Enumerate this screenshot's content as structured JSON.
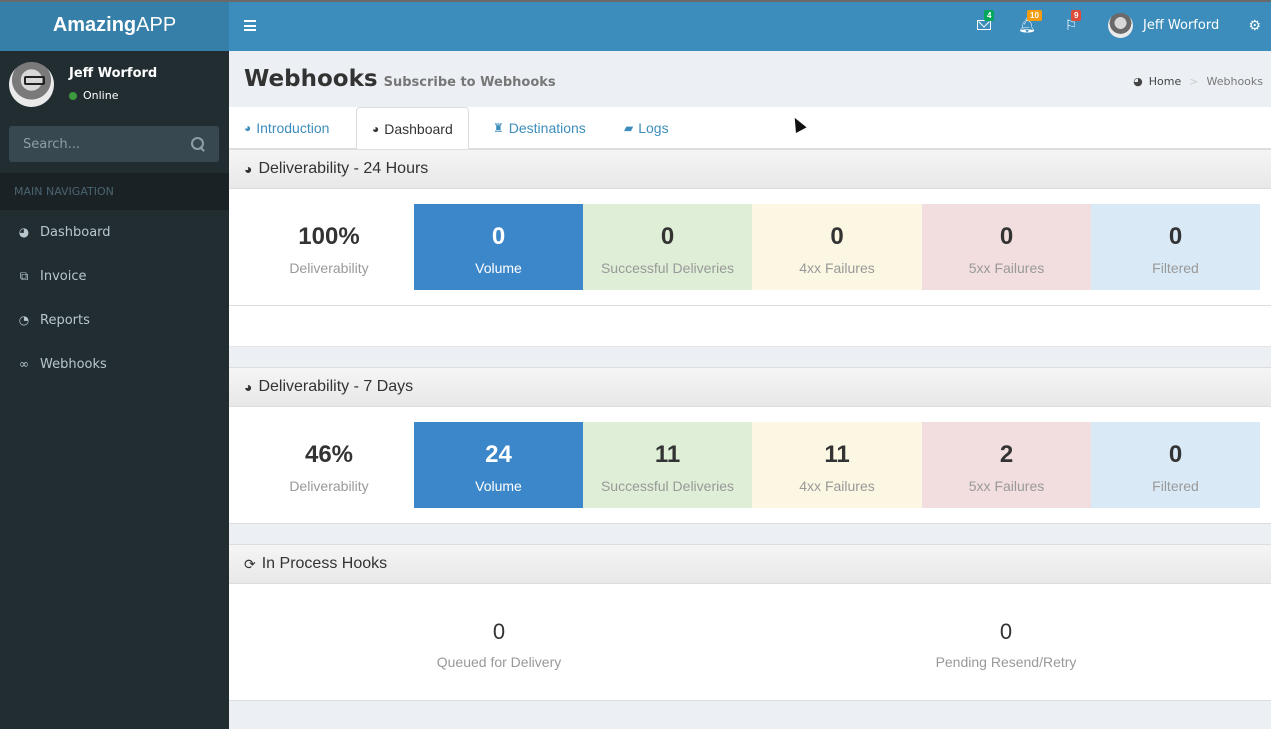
{
  "app": {
    "logo_bold": "Amazing",
    "logo_light": "APP"
  },
  "user": {
    "name": "Jeff Worford",
    "status": "Online",
    "status_color": "#3c9a3c"
  },
  "sidebar": {
    "search_placeholder": "Search...",
    "nav_header": "MAIN NAVIGATION",
    "items": [
      {
        "label": "Dashboard",
        "icon": "dashboard-icon"
      },
      {
        "label": "Invoice",
        "icon": "files-icon"
      },
      {
        "label": "Reports",
        "icon": "pie-chart-icon"
      },
      {
        "label": "Webhooks",
        "icon": "link-icon"
      }
    ]
  },
  "header": {
    "messages_count": "4",
    "notifications_count": "10",
    "tasks_count": "9",
    "user_name": "Jeff Worford",
    "colors": {
      "bar": "#3c8dbc",
      "messages_badge": "#00a65a",
      "notifications_badge": "#f39c12",
      "tasks_badge": "#dd4b39"
    }
  },
  "page": {
    "title": "Webhooks",
    "subtitle": "Subscribe to Webhooks",
    "breadcrumb": {
      "home": "Home",
      "current": "Webhooks"
    }
  },
  "tabs": [
    {
      "label": "Introduction",
      "active": false
    },
    {
      "label": "Dashboard",
      "active": true
    },
    {
      "label": "Destinations",
      "active": false
    },
    {
      "label": "Logs",
      "active": false
    }
  ],
  "deliverability_24h": {
    "title": "Deliverability - 24 Hours",
    "rate": "100%",
    "rate_label": "Deliverability",
    "stats": [
      {
        "value": "0",
        "label": "Volume"
      },
      {
        "value": "0",
        "label": "Successful Deliveries"
      },
      {
        "value": "0",
        "label": "4xx Failures"
      },
      {
        "value": "0",
        "label": "5xx Failures"
      },
      {
        "value": "0",
        "label": "Filtered"
      }
    ]
  },
  "deliverability_7d": {
    "title": "Deliverability - 7 Days",
    "rate": "46%",
    "rate_label": "Deliverability",
    "stats": [
      {
        "value": "24",
        "label": "Volume"
      },
      {
        "value": "11",
        "label": "Successful Deliveries"
      },
      {
        "value": "11",
        "label": "4xx Failures"
      },
      {
        "value": "2",
        "label": "5xx Failures"
      },
      {
        "value": "0",
        "label": "Filtered"
      }
    ]
  },
  "in_process": {
    "title": "In Process Hooks",
    "queued": {
      "value": "0",
      "label": "Queued for Delivery"
    },
    "pending": {
      "value": "0",
      "label": "Pending Resend/Retry"
    }
  }
}
